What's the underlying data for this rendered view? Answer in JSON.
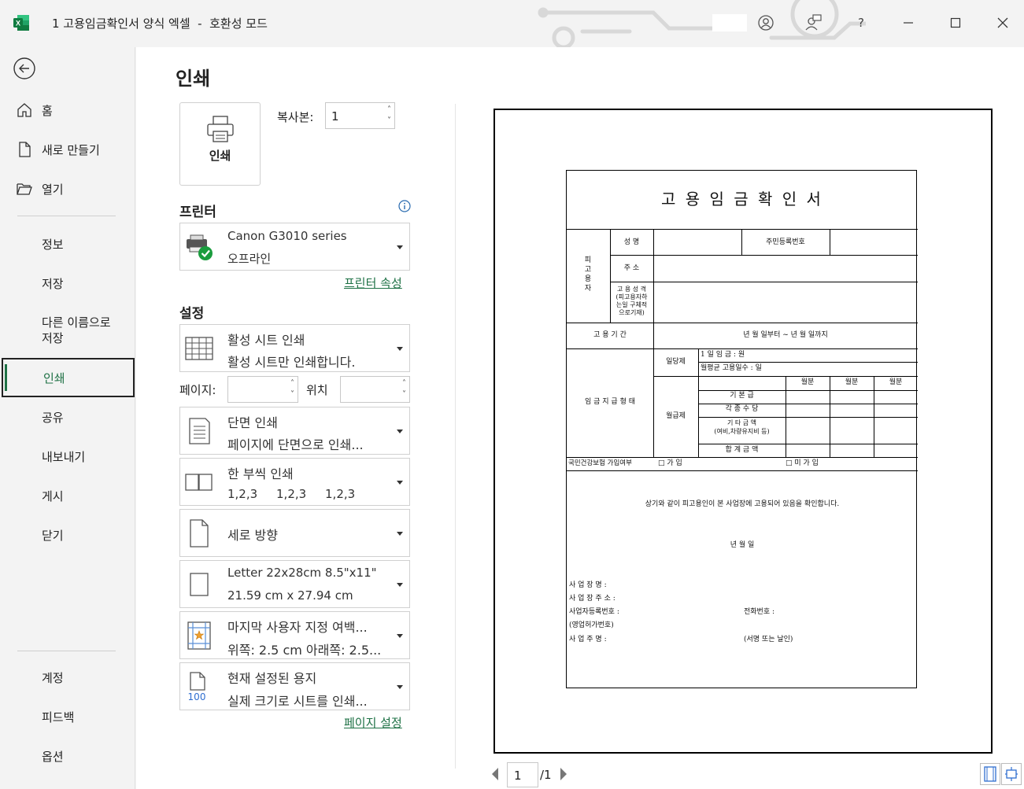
{
  "window": {
    "title": "1 고용임금확인서 양식 엑셀  -  호환성 모드",
    "help_label": "?"
  },
  "sidebar": {
    "items": [
      {
        "label": "홈",
        "icon": "home-icon"
      },
      {
        "label": "새로 만들기",
        "icon": "new-file-icon"
      },
      {
        "label": "열기",
        "icon": "open-folder-icon"
      },
      {
        "label": "정보"
      },
      {
        "label": "저장"
      },
      {
        "label": "다른 이름으로"
      },
      {
        "label": "인쇄"
      },
      {
        "label": "공유"
      },
      {
        "label": "내보내기"
      },
      {
        "label": "게시"
      },
      {
        "label": "닫기"
      },
      {
        "label": "계정"
      },
      {
        "label": "피드백"
      },
      {
        "label": "옵션"
      }
    ],
    "save_as_line2": "저장"
  },
  "print": {
    "page_title": "인쇄",
    "print_button": "인쇄",
    "copies_label": "복사본:",
    "copies_value": "1",
    "printer_section": "프린터",
    "printer_name": "Canon G3010 series",
    "printer_status": "오프라인",
    "printer_properties": "프린터 속성",
    "settings_section": "설정",
    "pages_label": "페이지:",
    "position_label": "위치",
    "page_setup": "페이지 설정"
  },
  "settings": [
    {
      "line1": "활성 시트 인쇄",
      "line2": "활성 시트만 인쇄합니다.",
      "icon": "sheet-grid-icon"
    },
    {
      "line1": "단면 인쇄",
      "line2": "페이지에 단면으로 인쇄...",
      "icon": "single-sided-icon"
    },
    {
      "line1": "한 부씩 인쇄",
      "line2": "1,2,3     1,2,3     1,2,3",
      "icon": "collate-icon"
    },
    {
      "line1": "세로 방향",
      "line2": "",
      "icon": "portrait-icon"
    },
    {
      "line1": "Letter 22x28cm 8.5\"x11\"",
      "line2": "21.59 cm x 27.94 cm",
      "icon": "paper-size-icon"
    },
    {
      "line1": "마지막 사용자 지정 여백...",
      "line2": "위쪽: 2.5 cm 아래쪽: 2.5...",
      "icon": "margins-icon"
    },
    {
      "line1": "현재 설정된 용지",
      "line2": "실제 크기로 시트를 인쇄...",
      "icon": "scaling-icon",
      "badge": "100"
    }
  ],
  "preview": {
    "page_current": "1",
    "page_total": "/1"
  },
  "document": {
    "title": "고 용 임 금 확 인 서",
    "employee_label": "피\n고\n용\n자",
    "name_label": "성  명",
    "rrn_label": "주민등록번호",
    "address_label": "주  소",
    "emp_type_l1": "고 용 성 격",
    "emp_type_l2": "(피고용자하",
    "emp_type_l3": "는일 구체적",
    "emp_type_l4": "으로기재)",
    "period_label": "고 용 기 간",
    "period_value": "년   월   일부터 ~   년  월  일까지",
    "wage_type_label": "임 금 지 급 형 태",
    "daily_label": "일당제",
    "daily_wage": "1 일 임 금 : 원",
    "monthly_days": "월평균 고용일수 : 일",
    "monthly_label": "월급제",
    "month_col": "월분",
    "base_pay": "기 본 급",
    "allowances": "각 종 수 당",
    "other_l1": "기 타 금 액",
    "other_l2": "(여비,차량유지비 등)",
    "total": "합 계 금 액",
    "insurance_label": "국민건강보험 가입여부",
    "ins_yes": "□ 가  입",
    "ins_no": "□ 미 가 입",
    "confirm_text": "상기와 같이 피고용인이 본 사업장에 고용되어 있음을 확인합니다.",
    "date_line": "년   월   일",
    "biz_name": "사 업 장 명 :",
    "biz_addr": "사 업 장 주 소 :",
    "biz_reg": "사업자등록번호 :",
    "phone": "전화번호 :",
    "license": "(영업허가번호)",
    "owner": "사 업 주 명 :",
    "seal": "(서명 또는 날인)"
  },
  "colors": {
    "accent": "#1e7145",
    "excel_green": "#107c41"
  }
}
